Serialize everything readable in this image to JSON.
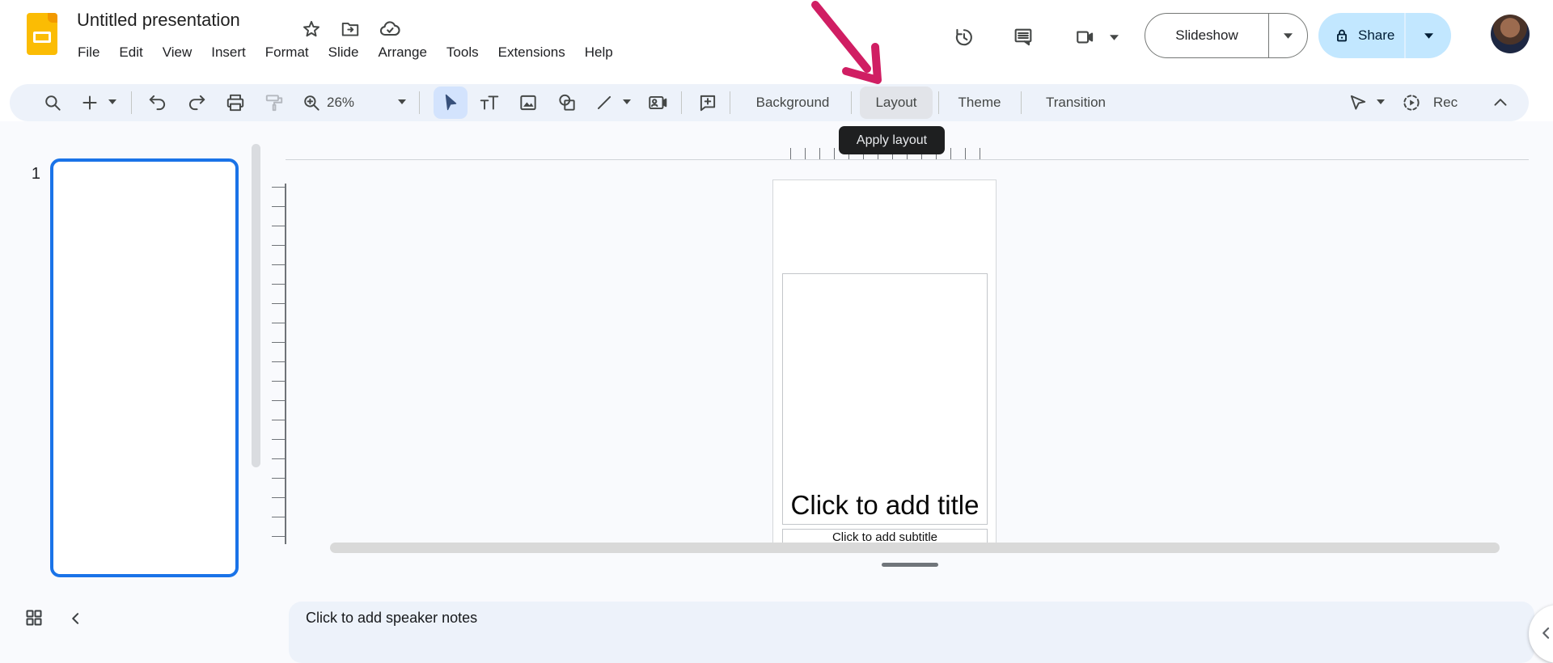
{
  "header": {
    "title": "Untitled presentation",
    "menu": [
      "File",
      "Edit",
      "View",
      "Insert",
      "Format",
      "Slide",
      "Arrange",
      "Tools",
      "Extensions",
      "Help"
    ],
    "slideshow_label": "Slideshow",
    "share_label": "Share"
  },
  "toolbar": {
    "zoom_value": "26%",
    "background_label": "Background",
    "layout_label": "Layout",
    "theme_label": "Theme",
    "transition_label": "Transition",
    "rec_label": "Rec"
  },
  "tooltip": {
    "text": "Apply layout"
  },
  "filmstrip": {
    "slide_number": "1"
  },
  "slide": {
    "title_placeholder": "Click to add title",
    "subtitle_placeholder": "Click to add subtitle"
  },
  "notes": {
    "placeholder": "Click to add speaker notes"
  },
  "colors": {
    "accent_blue": "#1a73e8",
    "toolbar_bg": "#edf2fa",
    "selected_tool_bg": "#d3e3fd",
    "share_bg": "#c2e7ff",
    "share_text": "#001d35",
    "tooltip_bg": "#1e1f20",
    "annotation_arrow": "#d01e63"
  }
}
